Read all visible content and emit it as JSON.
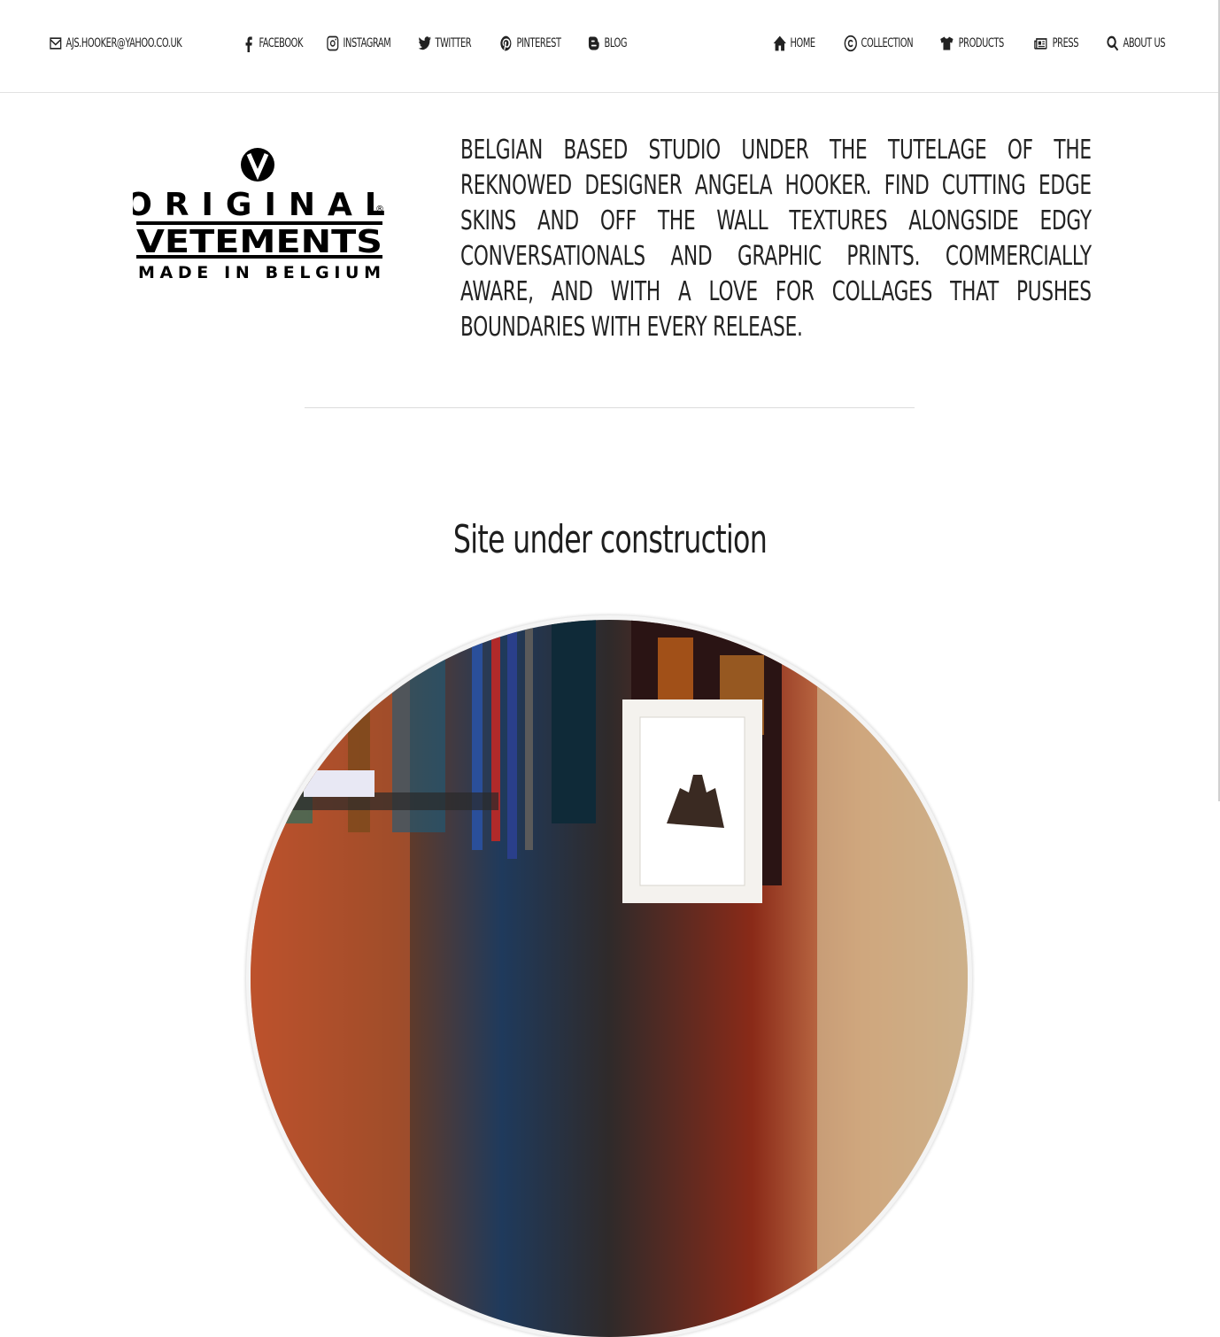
{
  "topbar": {
    "email": "AJS.HOOKER@YAHOO.CO.UK",
    "social": [
      {
        "label": "FACEBOOK",
        "icon": "facebook-icon"
      },
      {
        "label": "INSTAGRAM",
        "icon": "instagram-icon"
      },
      {
        "label": "TWITTER",
        "icon": "twitter-icon"
      },
      {
        "label": "PINTEREST",
        "icon": "pinterest-icon"
      },
      {
        "label": "BLOG",
        "icon": "blogger-icon"
      }
    ],
    "menu": [
      {
        "label": "HOME",
        "icon": "home-icon"
      },
      {
        "label": "COLLECTION",
        "icon": "copyright-icon"
      },
      {
        "label": "PRODUCTS",
        "icon": "tshirt-icon"
      },
      {
        "label": "PRESS",
        "icon": "newspaper-icon"
      },
      {
        "label": "ABOUT US",
        "icon": "search-icon"
      }
    ]
  },
  "logo": {
    "line1": "ORIGINAL",
    "line2": "VETEMENTS",
    "line3": "MADE IN BELGIUM",
    "mark": "V",
    "registered": "®"
  },
  "intro": {
    "text": "BELGIAN BASED STUDIO UNDER THE TUTELAGE OF THE REKNOWED DESIGNER ANGELA HOOKER. FIND CUTTING EDGE SKINS AND OFF THE WALL TEXTURES ALONGSIDE EDGY CONVERSATIONALS AND GRAPHIC PRINTS. COMMERCIALLY AWARE, AND WITH A LOVE FOR COLLAGES THAT PUSHES BOUNDARIES WITH EVERY RELEASE."
  },
  "main": {
    "heading": "Site under construction"
  },
  "colors": {
    "text": "#1a1a1a",
    "divider": "#dcdcdc",
    "background": "#ffffff"
  }
}
